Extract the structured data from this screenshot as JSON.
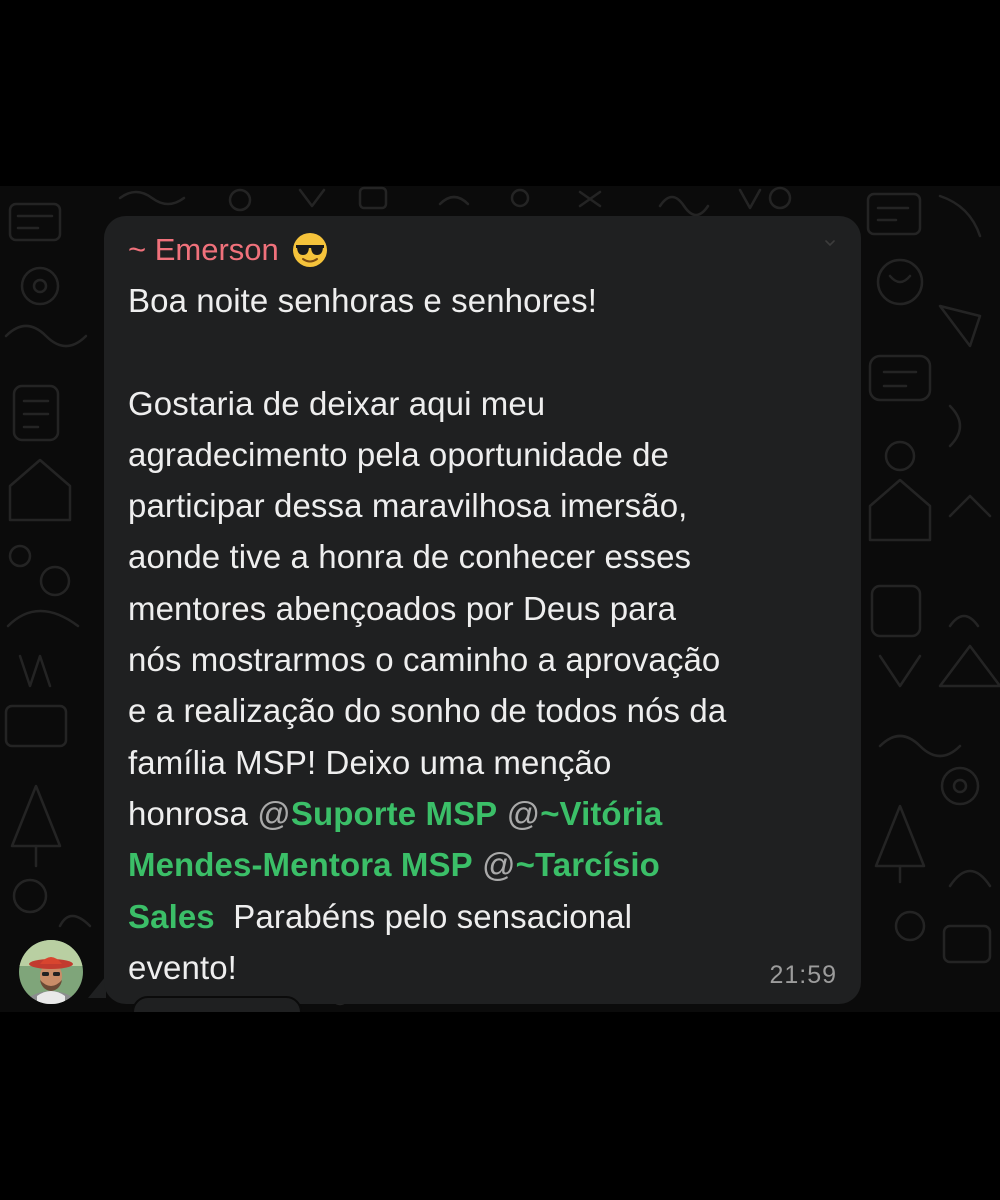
{
  "sender": {
    "name": "~ Emerson",
    "emoji_icon": "sunglasses-emoji-icon",
    "name_color": "#f0717b"
  },
  "message": {
    "greeting": "Boa noite senhoras e senhores!",
    "body_part1": "Gostaria de deixar aqui meu\nagradecimento pela oportunidade de\nparticipar dessa maravilhosa imersão,\naonde tive a honra de conhecer esses\nmentores abençoados por Deus para\nnós mostrarmos o caminho a aprovação\ne a realização do sonho de todos nós da\nfamília MSP! Deixo uma menção\nhonrosa ",
    "mentions": [
      {
        "at": "@",
        "name": "Suporte MSP"
      },
      {
        "at": "@",
        "name": "~Vitória\nMendes-Mentora MSP"
      },
      {
        "at": "@",
        "name": "~Tarcísio\nSales"
      }
    ],
    "closing": "  Parabéns pelo sensacional\nevento!",
    "time": "21:59",
    "mention_color": "#3bbf68"
  },
  "avatar_icon": "user-avatar-icon",
  "bubble_color": "#1f2021",
  "background_color": "#0b0b0b"
}
